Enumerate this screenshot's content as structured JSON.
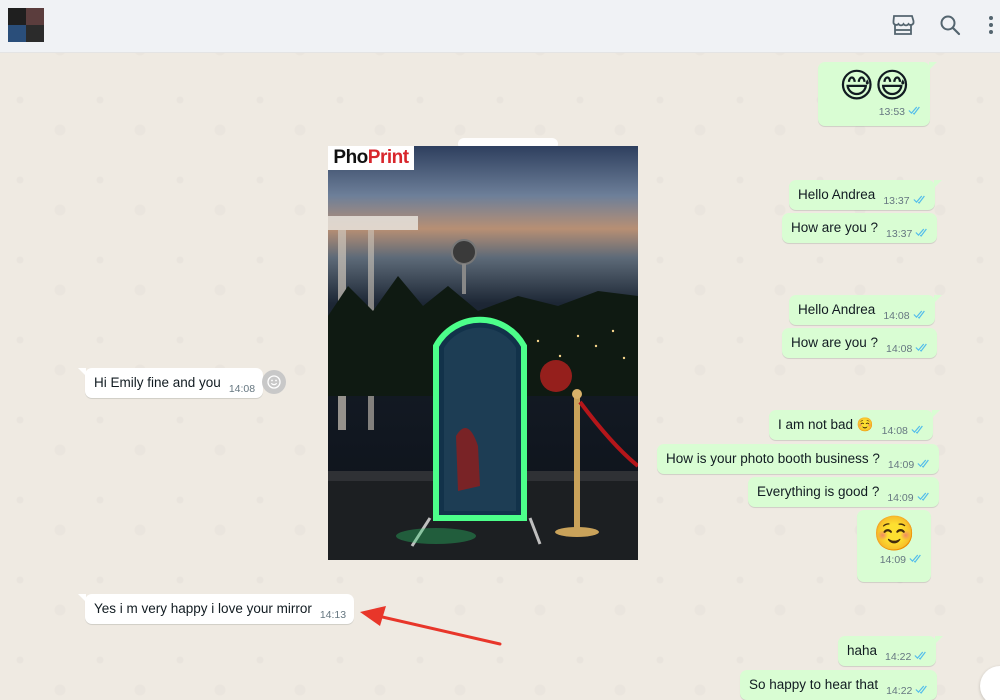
{
  "header": {
    "icons": [
      "store-icon",
      "search-icon",
      "more-icon"
    ]
  },
  "photo": {
    "logo_prefix": "Pho",
    "logo_suffix": "Print"
  },
  "messages": [
    {
      "id": "m1",
      "dir": "out",
      "text": "😅😅",
      "time": "13:53",
      "big_emoji": true
    },
    {
      "id": "m2",
      "dir": "out",
      "text": "Hello Andrea",
      "time": "13:37"
    },
    {
      "id": "m3",
      "dir": "out",
      "text": "How are you ?",
      "time": "13:37"
    },
    {
      "id": "m4",
      "dir": "out",
      "text": "Hello Andrea",
      "time": "14:08"
    },
    {
      "id": "m5",
      "dir": "out",
      "text": "How are you ?",
      "time": "14:08"
    },
    {
      "id": "m6",
      "dir": "in",
      "text": "Hi Emily fine and you",
      "time": "14:08"
    },
    {
      "id": "m7",
      "dir": "out",
      "text": "I am not bad ☺️",
      "time": "14:08"
    },
    {
      "id": "m8",
      "dir": "out",
      "text": "How is your photo booth business ?",
      "time": "14:09"
    },
    {
      "id": "m9",
      "dir": "out",
      "text": "Everything is good ?",
      "time": "14:09"
    },
    {
      "id": "m10",
      "dir": "out",
      "text": "☺️",
      "time": "14:09",
      "big_emoji": true
    },
    {
      "id": "m11",
      "dir": "in",
      "text": "Yes i m very happy i love your mirror",
      "time": "14:13"
    },
    {
      "id": "m12",
      "dir": "out",
      "text": "haha",
      "time": "14:22"
    },
    {
      "id": "m13",
      "dir": "out",
      "text": "So happy to hear that",
      "time": "14:22"
    }
  ],
  "colors": {
    "outgoing_bubble": "#d9fdd3",
    "incoming_bubble": "#ffffff",
    "read_ticks": "#53bdeb",
    "annotation_arrow": "#e8362a"
  }
}
